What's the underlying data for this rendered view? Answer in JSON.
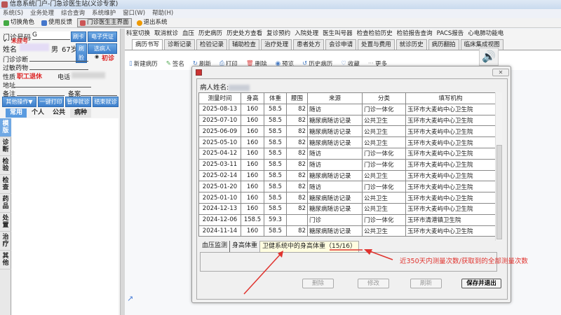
{
  "window": {
    "title": "信息系统门户-门急诊医生站(义诊专家)"
  },
  "menu": [
    "系统(S)",
    "业务处理",
    "综合查询",
    "系统维护",
    "窗口(W)",
    "帮助(H)"
  ],
  "toolbar": [
    "切换角色",
    "使用反馈",
    "门诊医生主界面",
    "退出系统"
  ],
  "patient": {
    "clinic_no_label": "门诊号码",
    "clinic_no_prefix": "G",
    "card_button": "刷卡",
    "e_voucher_button": "电子凭证",
    "unregistered": "未挂号",
    "name_label": "姓名",
    "gender": "男",
    "age": "67岁",
    "face_button": "刷脸",
    "select_patient_button": "选病人",
    "diagnosis_label": "门诊诊断",
    "first_visit": "初诊",
    "allergy_label": "过敏药物",
    "nature_label": "性质",
    "nature_value": "职工退休",
    "phone_label": "电话",
    "address_label": "地址",
    "remark_label": "备注",
    "filing_label": "备案",
    "actions": [
      "其他操作▼",
      "一键打印",
      "暂停就诊",
      "结束就诊"
    ]
  },
  "left_tabs": [
    "常用",
    "个人",
    "公共",
    "病种"
  ],
  "vertical_tabs": [
    "模版",
    "诊断",
    "检验",
    "检查",
    "药品",
    "处置",
    "治疗",
    "其他"
  ],
  "right_toolbar": [
    "科室切换",
    "取消就诊",
    "血压",
    "历史病历",
    "历史处方查看",
    "复诊预约",
    "入院处理",
    "医生叫号器",
    "检查检验历史",
    "检验报告查询",
    "PACS报告",
    "心电肺功能电"
  ],
  "right_tabs": [
    "病历书写",
    "诊断记录",
    "检验记录",
    "辅助检查",
    "治疗处理",
    "患者处方",
    "会诊申请",
    "处置与费用",
    "就诊历史",
    "病历翻拍",
    "临床集成视图"
  ],
  "actions": [
    {
      "icon": "document-icon",
      "label": "新建病历"
    },
    {
      "icon": "pen-icon",
      "label": "签名"
    },
    {
      "icon": "refresh-icon",
      "label": "刷新"
    },
    {
      "icon": "printer-icon",
      "label": "打印"
    },
    {
      "icon": "trash-icon",
      "label": "删除"
    },
    {
      "icon": "eye-icon",
      "label": "预览"
    },
    {
      "icon": "history-icon",
      "label": "历史病历"
    },
    {
      "icon": "heart-icon",
      "label": "收藏"
    },
    {
      "icon": "more-icon",
      "label": "更多"
    }
  ],
  "dialog": {
    "patient_name_label": "病人姓名:",
    "columns": [
      "测量时间",
      "身高",
      "体重",
      "腰围",
      "来源",
      "分类",
      "填写机构"
    ],
    "rows": [
      [
        "2025-08-13",
        "160",
        "58.5",
        "82",
        "随访",
        "门诊一体化",
        "玉环市大麦屿中心卫生院"
      ],
      [
        "2025-07-10",
        "160",
        "58.5",
        "82",
        "糖尿病随访记录",
        "公共卫生",
        "玉环市大麦屿中心卫生院"
      ],
      [
        "2025-06-09",
        "160",
        "58.5",
        "82",
        "糖尿病随访记录",
        "公共卫生",
        "玉环市大麦屿中心卫生院"
      ],
      [
        "2025-05-10",
        "160",
        "58.5",
        "82",
        "糖尿病随访记录",
        "公共卫生",
        "玉环市大麦屿中心卫生院"
      ],
      [
        "2025-04-12",
        "160",
        "58.5",
        "82",
        "随访",
        "门诊一体化",
        "玉环市大麦屿中心卫生院"
      ],
      [
        "2025-03-11",
        "160",
        "58.5",
        "82",
        "随访",
        "门诊一体化",
        "玉环市大麦屿中心卫生院"
      ],
      [
        "2025-02-14",
        "160",
        "58.5",
        "82",
        "糖尿病随访记录",
        "公共卫生",
        "玉环市大麦屿中心卫生院"
      ],
      [
        "2025-01-20",
        "160",
        "58.5",
        "82",
        "随访",
        "门诊一体化",
        "玉环市大麦屿中心卫生院"
      ],
      [
        "2025-01-10",
        "160",
        "58.5",
        "82",
        "糖尿病随访记录",
        "公共卫生",
        "玉环市大麦屿中心卫生院"
      ],
      [
        "2024-12-13",
        "160",
        "58.5",
        "82",
        "糖尿病随访记录",
        "公共卫生",
        "玉环市大麦屿中心卫生院"
      ],
      [
        "2024-12-06",
        "158.5",
        "59.3",
        "",
        "门诊",
        "门诊一体化",
        "玉环市清港镇卫生院"
      ],
      [
        "2024-11-14",
        "160",
        "58.5",
        "82",
        "糖尿病随访记录",
        "公共卫生",
        "玉环市大麦屿中心卫生院"
      ]
    ],
    "tabs": [
      "血压监测",
      "身高体重",
      "卫健系统中的身高体重（15/16）"
    ],
    "buttons": {
      "delete": "删除",
      "modify": "修改",
      "refresh": "刷新",
      "save_exit": "保存并退出"
    }
  },
  "annotation": "近350天内测量次数/获取到的全部测量次数",
  "colors": {
    "annotation": "#e0332e",
    "accent": "#3d7fcc",
    "highlight_tab": "#fffde0"
  }
}
